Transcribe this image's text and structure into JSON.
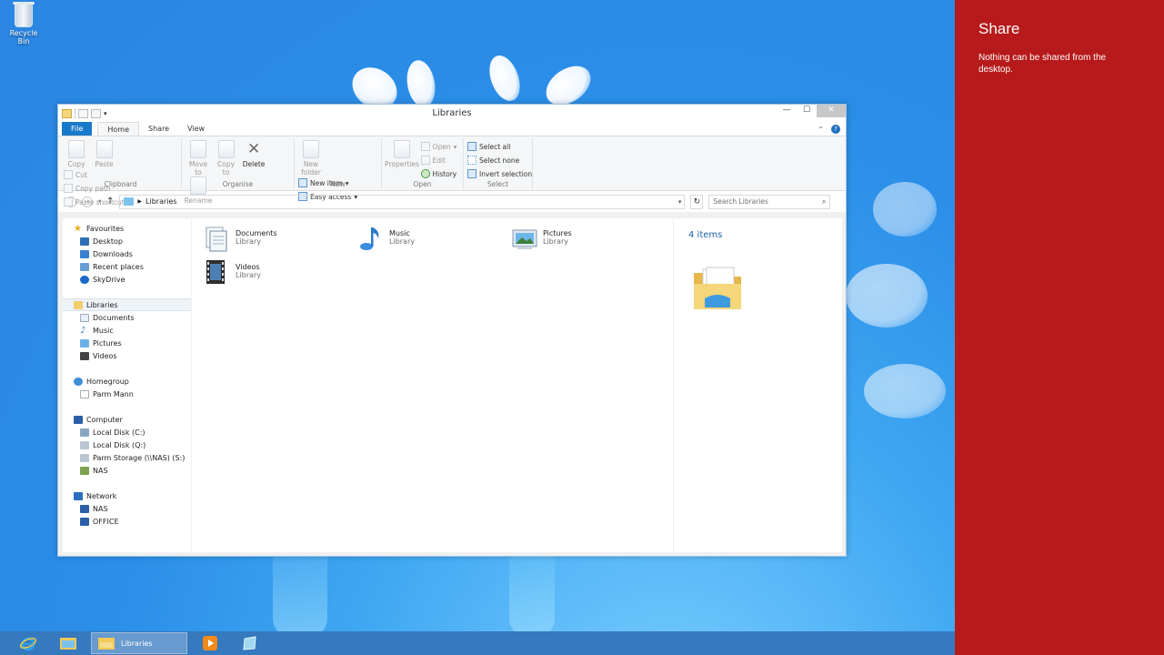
{
  "desktop": {
    "recycle_bin_label": "Recycle Bin"
  },
  "window": {
    "title": "Libraries",
    "caption_buttons": [
      "minimize-icon",
      "maximize-icon",
      "close-icon"
    ],
    "tabs": [
      {
        "label": "File"
      },
      {
        "label": "Home"
      },
      {
        "label": "Share"
      },
      {
        "label": "View"
      }
    ],
    "help_glyph": "?",
    "ribbon": {
      "clipboard": {
        "label": "Clipboard",
        "copy": "Copy",
        "paste": "Paste",
        "cut": "Cut",
        "copy_path": "Copy path",
        "paste_shortcut": "Paste shortcut"
      },
      "organise": {
        "label": "Organise",
        "move_to": "Move",
        "move_to_2": "to",
        "copy_to": "Copy",
        "copy_to_2": "to",
        "delete": "Delete",
        "rename": "Rename"
      },
      "new": {
        "label": "New",
        "new_folder": "New",
        "new_folder_2": "folder",
        "new_item": "New item",
        "easy_access": "Easy access"
      },
      "open": {
        "label": "Open",
        "properties": "Properties",
        "open": "Open",
        "edit": "Edit",
        "history": "History"
      },
      "select": {
        "label": "Select",
        "select_all": "Select all",
        "select_none": "Select none",
        "invert_selection": "Invert selection"
      }
    },
    "address": {
      "path": "Libraries",
      "search_placeholder": "Search Libraries"
    },
    "nav": {
      "favourites": "Favourites",
      "desktop": "Desktop",
      "downloads": "Downloads",
      "recent_places": "Recent places",
      "skydrive": "SkyDrive",
      "libraries": "Libraries",
      "documents": "Documents",
      "music": "Music",
      "pictures": "Pictures",
      "videos": "Videos",
      "homegroup": "Homegroup",
      "parm_mann": "Parm Mann",
      "computer": "Computer",
      "local_c": "Local Disk (C:)",
      "local_q": "Local Disk (Q:)",
      "parm_storage": "Parm Storage (\\\\NAS) (S:)",
      "nas": "NAS",
      "network": "Network",
      "net_nas": "NAS",
      "net_office": "OFFICE"
    },
    "items": [
      {
        "name": "Documents",
        "type": "Library"
      },
      {
        "name": "Music",
        "type": "Library"
      },
      {
        "name": "Pictures",
        "type": "Library"
      },
      {
        "name": "Videos",
        "type": "Library"
      }
    ],
    "preview": {
      "count": "4 items"
    }
  },
  "charm": {
    "title": "Share",
    "message": "Nothing can be shared from the desktop."
  },
  "taskbar": {
    "active_label": "Libraries"
  }
}
